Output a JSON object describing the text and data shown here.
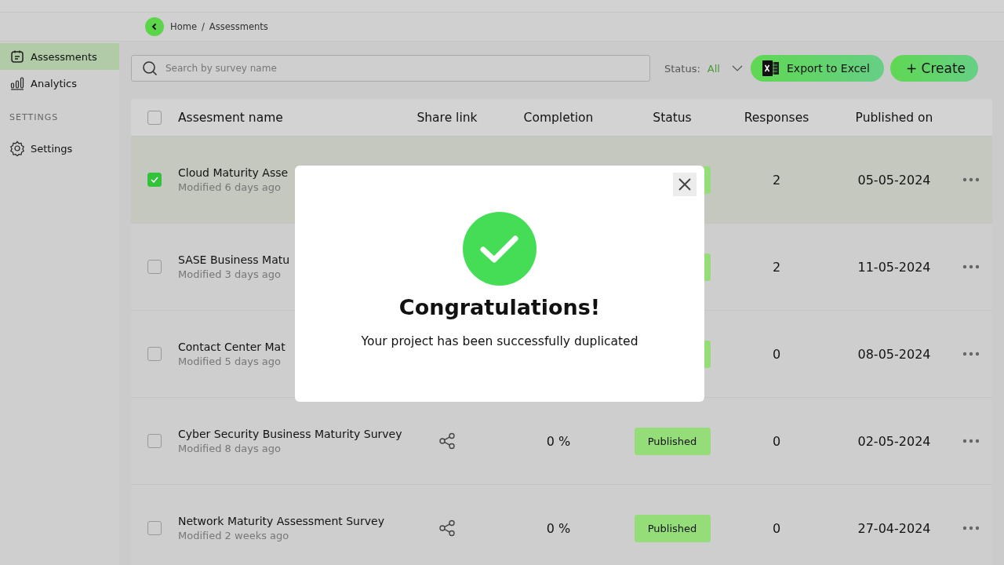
{
  "breadcrumb": {
    "items": [
      "Home",
      "Assessments"
    ],
    "separator": "/"
  },
  "sidebar": {
    "items": [
      {
        "label": "Assessments",
        "kind": "calendar",
        "selected": true
      },
      {
        "label": "Analytics",
        "kind": "bars",
        "selected": false
      }
    ],
    "section_label": "SETTINGS",
    "section_items": [
      {
        "label": "Settings",
        "kind": "gear",
        "selected": false
      }
    ]
  },
  "toolbar": {
    "search": {
      "placeholder": "Search by survey name"
    },
    "status_label": "Status:",
    "status_value": "All",
    "export_button": "Export to Excel",
    "create_button": "+ Create"
  },
  "table": {
    "columns": [
      "Assesment name",
      "Share link",
      "Completion",
      "Status",
      "Responses",
      "Published on"
    ],
    "header_checked": false,
    "rows": [
      {
        "name": "Cloud Maturity Asse",
        "modified": "Modified 6 days ago",
        "checked": true,
        "selected": true,
        "responses": "2",
        "published": "05-05-2024"
      },
      {
        "name": "SASE Business Matu",
        "modified": "Modified 3 days ago",
        "checked": false,
        "selected": false,
        "responses": "2",
        "published": "11-05-2024"
      },
      {
        "name": "Contact Center Mat",
        "modified": "Modified 5 days ago",
        "checked": false,
        "selected": false,
        "responses": "0",
        "published": "08-05-2024"
      },
      {
        "name": "Cyber Security Business Maturity Survey",
        "modified": "Modified 8 days ago",
        "checked": false,
        "selected": false,
        "completion": "0 %",
        "status": "Published",
        "responses": "0",
        "published": "02-05-2024"
      },
      {
        "name": "Network Maturity Assessment Survey",
        "modified": "Modified 2 weeks ago",
        "checked": false,
        "selected": false,
        "completion": "0 %",
        "status": "Published",
        "responses": "0",
        "published": "27-04-2024"
      }
    ]
  },
  "dialog": {
    "title": "Congratulations!",
    "message": "Your project has been successfully duplicated"
  }
}
